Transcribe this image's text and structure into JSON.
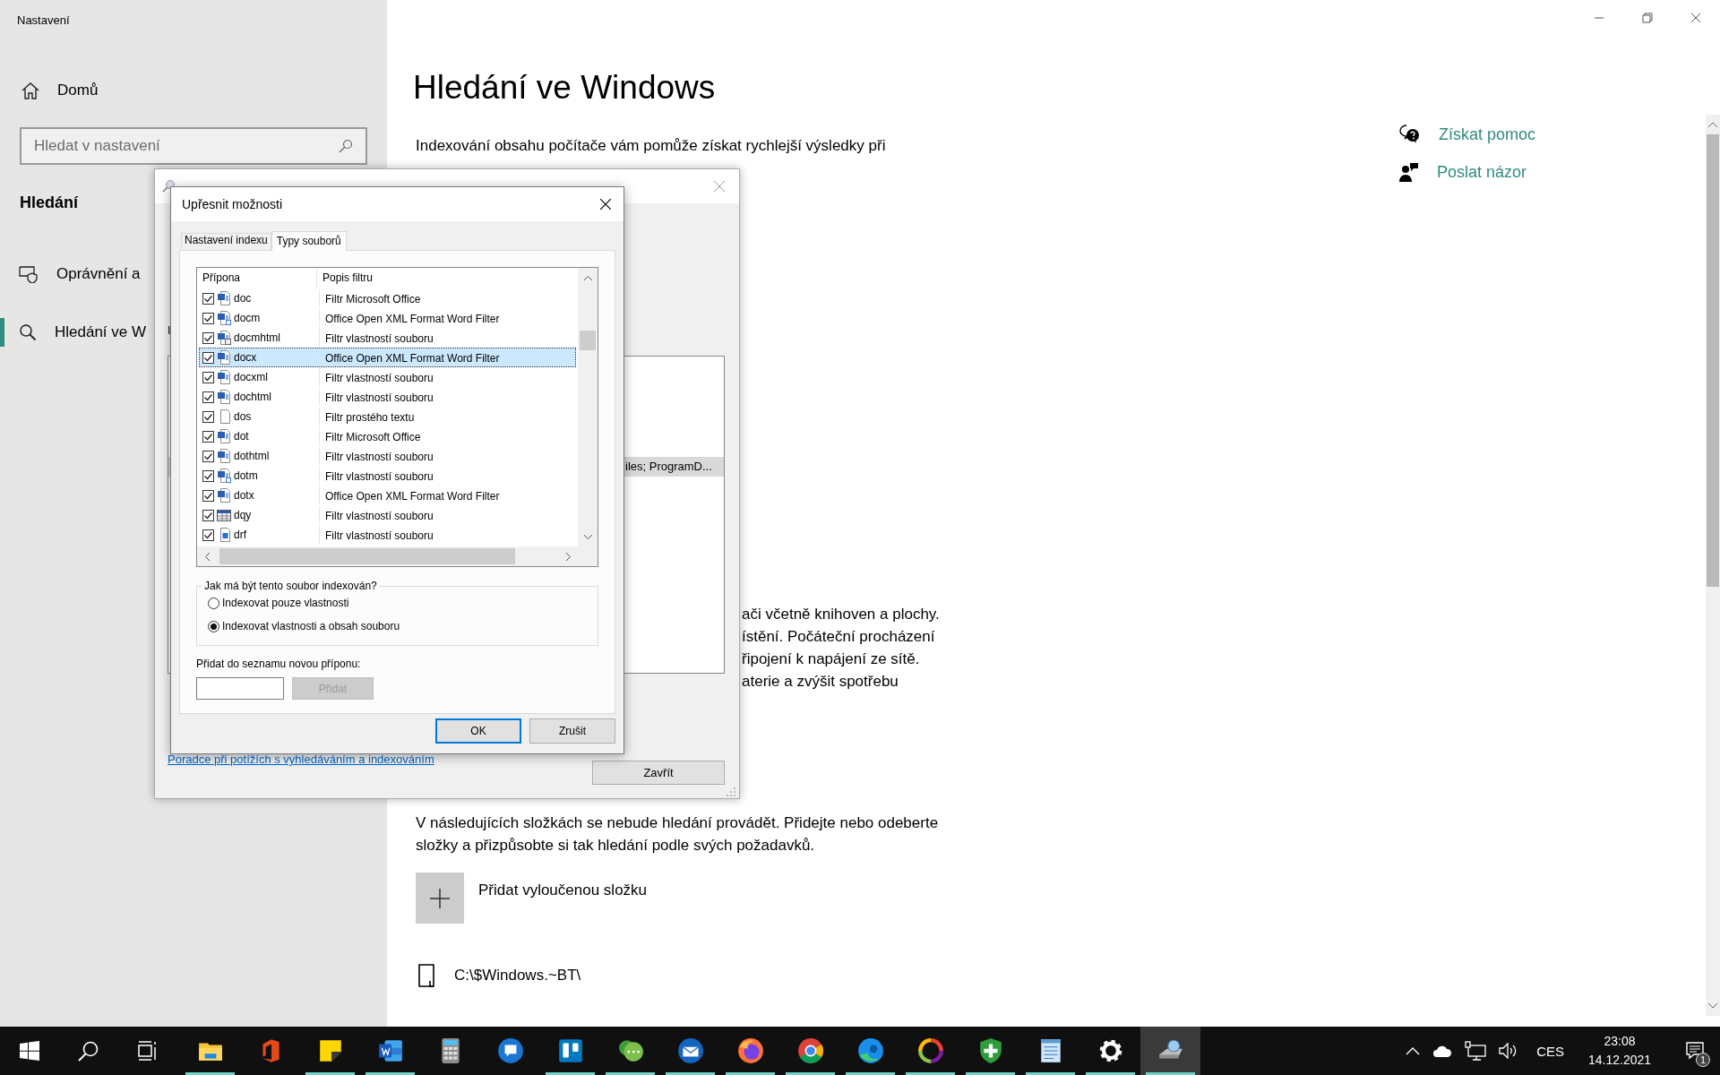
{
  "window": {
    "title": "Nastavení"
  },
  "sidebar": {
    "home": "Domů",
    "search": {
      "placeholder": "Hledat v nastavení"
    },
    "section": "Hledání",
    "items": [
      {
        "label": "Oprávnění a",
        "kind": "permissions",
        "selected": false
      },
      {
        "label": "Hledání ve W",
        "kind": "search",
        "selected": true
      }
    ]
  },
  "page": {
    "title": "Hledání ve Windows",
    "intro": "Indexování obsahu počítače vám pomůže získat rychlejší výsledky při",
    "partial_lines": [
      "ači včetně knihoven a plochy.",
      "ístění. Počáteční procházení",
      "řipojení k napájení ze sítě.",
      "aterie a zvýšit spotřebu"
    ],
    "excluded": {
      "text": "V následujících složkách se nebude hledání provádět. Přidejte nebo odeberte složky a přizpůsobte si tak hledání podle svých požadavků.",
      "add_label": "Přidat vyloučenou složku",
      "folders": [
        "C:\\$Windows.~BT\\"
      ]
    }
  },
  "related": [
    {
      "label": "Získat pomoc",
      "kind": "help"
    },
    {
      "label": "Poslat názor",
      "kind": "feedback"
    }
  ],
  "indexing_dialog": {
    "label_fragment": "I",
    "list_row": "iles; ProgramD...",
    "troubleshoot_link": "Poradce při potížích s vyhledáváním a indexováním",
    "close_button": "Zavřít"
  },
  "advanced_dialog": {
    "title": "Upřesnit možnosti",
    "tabs": [
      {
        "label": "Nastavení indexu",
        "selected": false
      },
      {
        "label": "Typy souborů",
        "selected": true
      }
    ],
    "table": {
      "columns": [
        "Přípona",
        "Popis filtru"
      ],
      "rows": [
        {
          "ext": "doc",
          "filter": "Filtr Microsoft Office",
          "kind": "word",
          "checked": true,
          "selected": false
        },
        {
          "ext": "docm",
          "filter": "Office Open XML Format Word Filter",
          "kind": "word-macro",
          "checked": true,
          "selected": false
        },
        {
          "ext": "docmhtml",
          "filter": "Filtr vlastností souboru",
          "kind": "word-html",
          "checked": true,
          "selected": false
        },
        {
          "ext": "docx",
          "filter": "Office Open XML Format Word Filter",
          "kind": "word",
          "checked": true,
          "selected": true
        },
        {
          "ext": "docxml",
          "filter": "Filtr vlastností souboru",
          "kind": "word",
          "checked": true,
          "selected": false
        },
        {
          "ext": "dochtml",
          "filter": "Filtr vlastností souboru",
          "kind": "word",
          "checked": true,
          "selected": false
        },
        {
          "ext": "dos",
          "filter": "Filtr prostého textu",
          "kind": "text",
          "checked": true,
          "selected": false
        },
        {
          "ext": "dot",
          "filter": "Filtr Microsoft Office",
          "kind": "word",
          "checked": true,
          "selected": false
        },
        {
          "ext": "dothtml",
          "filter": "Filtr vlastností souboru",
          "kind": "word",
          "checked": true,
          "selected": false
        },
        {
          "ext": "dotm",
          "filter": "Filtr vlastností souboru",
          "kind": "word-macro",
          "checked": true,
          "selected": false
        },
        {
          "ext": "dotx",
          "filter": "Office Open XML Format Word Filter",
          "kind": "word",
          "checked": true,
          "selected": false
        },
        {
          "ext": "dqy",
          "filter": "Filtr vlastností souboru",
          "kind": "query",
          "checked": true,
          "selected": false
        },
        {
          "ext": "drf",
          "filter": "Filtr vlastností souboru",
          "kind": "image",
          "checked": true,
          "selected": false
        }
      ]
    },
    "group": {
      "legend": "Jak má být tento soubor indexován?",
      "options": [
        {
          "label": "Indexovat pouze vlastnosti",
          "selected": false
        },
        {
          "label": "Indexovat vlastnosti a obsah souboru",
          "selected": true
        }
      ]
    },
    "add": {
      "label": "Přidat do seznamu novou příponu:",
      "button": "Přidat",
      "disabled": true
    },
    "buttons": [
      {
        "label": "OK",
        "default": true
      },
      {
        "label": "Zrušit",
        "default": false
      }
    ]
  },
  "taskbar": {
    "apps": [
      {
        "kind": "explorer",
        "running": true,
        "active": false
      },
      {
        "kind": "office",
        "running": false,
        "active": false
      },
      {
        "kind": "sticky",
        "running": true,
        "active": false
      },
      {
        "kind": "word",
        "running": true,
        "active": false
      },
      {
        "kind": "calculator",
        "running": false,
        "active": false
      },
      {
        "kind": "chat",
        "running": false,
        "active": false
      },
      {
        "kind": "board",
        "running": true,
        "active": false
      },
      {
        "kind": "messenger",
        "running": true,
        "active": false
      },
      {
        "kind": "mail",
        "running": true,
        "active": false
      },
      {
        "kind": "fox",
        "running": true,
        "active": false
      },
      {
        "kind": "chrome",
        "running": true,
        "active": false
      },
      {
        "kind": "edge",
        "running": true,
        "active": false
      },
      {
        "kind": "ring",
        "running": true,
        "active": false
      },
      {
        "kind": "shield",
        "running": true,
        "active": false
      },
      {
        "kind": "notepad",
        "running": true,
        "active": false
      },
      {
        "kind": "settings",
        "running": true,
        "active": false
      },
      {
        "kind": "drive",
        "running": true,
        "active": true
      }
    ],
    "tray": {
      "language": "CES",
      "time": "23:08",
      "date": "14.12.2021",
      "notifications": "1"
    }
  }
}
